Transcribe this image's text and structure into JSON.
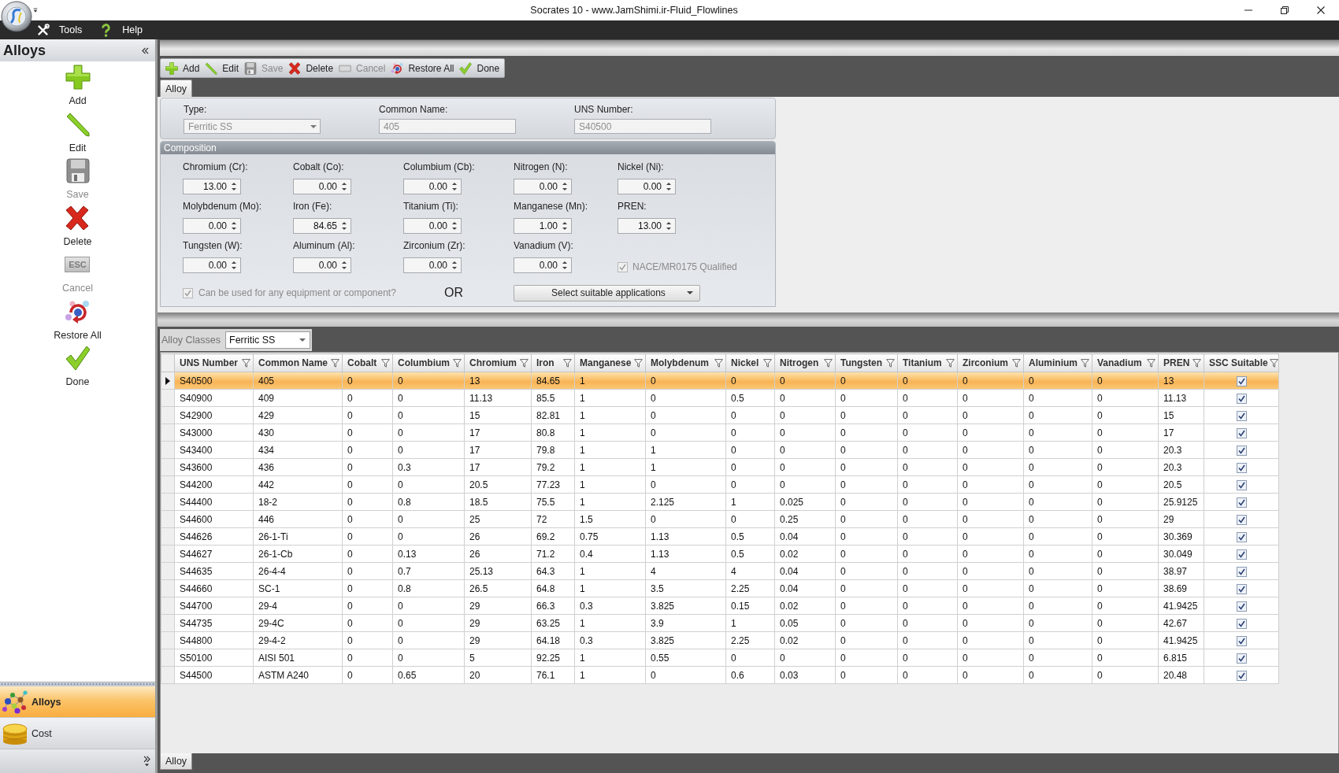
{
  "window": {
    "title": "Socrates 10 - www.JamShimi.ir-Fluid_Flowlines"
  },
  "menu": [
    {
      "label": "Tools"
    },
    {
      "label": "Help"
    }
  ],
  "sidebar": {
    "title": "Alloys",
    "actions": [
      {
        "label": "Add",
        "disabled": false
      },
      {
        "label": "Edit",
        "disabled": false
      },
      {
        "label": "Save",
        "disabled": true
      },
      {
        "label": "Delete",
        "disabled": false
      },
      {
        "label": "Cancel",
        "disabled": true,
        "key_label": "ESC"
      },
      {
        "label": "Restore All",
        "disabled": false
      },
      {
        "label": "Done",
        "disabled": false
      }
    ],
    "nav": [
      {
        "label": "Alloys",
        "selected": true
      },
      {
        "label": "Cost",
        "selected": false
      }
    ]
  },
  "toolbar": {
    "actions": [
      {
        "label": "Add",
        "disabled": false
      },
      {
        "label": "Edit",
        "disabled": false
      },
      {
        "label": "Save",
        "disabled": true
      },
      {
        "label": "Delete",
        "disabled": false
      },
      {
        "label": "Cancel",
        "disabled": true
      },
      {
        "label": "Restore All",
        "disabled": false
      },
      {
        "label": "Done",
        "disabled": false
      }
    ]
  },
  "tabs": [
    {
      "label": "Alloy",
      "selected": true
    }
  ],
  "form": {
    "header_fields": [
      {
        "kind": "dropdown",
        "label": "Type:",
        "value": "Ferritic SS",
        "disabled": true
      },
      {
        "kind": "text",
        "label": "Common Name:",
        "value": "405",
        "disabled": true
      },
      {
        "kind": "text",
        "label": "UNS Number:",
        "value": "S40500",
        "disabled": true
      }
    ],
    "composition": {
      "title": "Composition",
      "fields": [
        {
          "label": "Chromium (Cr):",
          "value": "13.00"
        },
        {
          "label": "Cobalt (Co):",
          "value": "0.00"
        },
        {
          "label": "Columbium (Cb):",
          "value": "0.00"
        },
        {
          "label": "Nitrogen (N):",
          "value": "0.00"
        },
        {
          "label": "Nickel (Ni):",
          "value": "0.00"
        },
        {
          "label": "Molybdenum (Mo):",
          "value": "0.00"
        },
        {
          "label": "Iron (Fe):",
          "value": "84.65"
        },
        {
          "label": "Titanium (Ti):",
          "value": "0.00"
        },
        {
          "label": "Manganese (Mn):",
          "value": "1.00"
        },
        {
          "label": "PREN:",
          "value": "13.00"
        },
        {
          "label": "Tungsten (W):",
          "value": "0.00"
        },
        {
          "label": "Aluminum (Al):",
          "value": "0.00"
        },
        {
          "label": "Zirconium (Zr):",
          "value": "0.00"
        },
        {
          "label": "Vanadium (V):",
          "value": "0.00"
        }
      ]
    },
    "nace": {
      "label": "NACE/MR0175 Qualified",
      "checked": true,
      "disabled": true
    },
    "any_equipment": {
      "label": "Can be used for any equipment or component?",
      "checked": true,
      "disabled": true
    },
    "or_text": "OR",
    "applications": {
      "label": "Select suitable applications"
    }
  },
  "alloy_classes": {
    "label": "Alloy Classes",
    "value": "Ferritic SS"
  },
  "table": {
    "columns": [
      "UNS Number",
      "Common Name",
      "Cobalt",
      "Columbium",
      "Chromium",
      "Iron",
      "Manganese",
      "Molybdenum",
      "Nickel",
      "Nitrogen",
      "Tungsten",
      "Titanium",
      "Zirconium",
      "Aluminium",
      "Vanadium",
      "PREN",
      "SSC Suitable"
    ],
    "rows": [
      {
        "selected": true,
        "cells": [
          "S40500",
          "405",
          "0",
          "0",
          "13",
          "84.65",
          "1",
          "0",
          "0",
          "0",
          "0",
          "0",
          "0",
          "0",
          "0",
          "13"
        ],
        "ssc_suitable": true
      },
      {
        "selected": false,
        "cells": [
          "S40900",
          "409",
          "0",
          "0",
          "11.13",
          "85.5",
          "1",
          "0",
          "0.5",
          "0",
          "0",
          "0",
          "0",
          "0",
          "0",
          "11.13"
        ],
        "ssc_suitable": true
      },
      {
        "selected": false,
        "cells": [
          "S42900",
          "429",
          "0",
          "0",
          "15",
          "82.81",
          "1",
          "0",
          "0",
          "0",
          "0",
          "0",
          "0",
          "0",
          "0",
          "15"
        ],
        "ssc_suitable": true
      },
      {
        "selected": false,
        "cells": [
          "S43000",
          "430",
          "0",
          "0",
          "17",
          "80.8",
          "1",
          "0",
          "0",
          "0",
          "0",
          "0",
          "0",
          "0",
          "0",
          "17"
        ],
        "ssc_suitable": true
      },
      {
        "selected": false,
        "cells": [
          "S43400",
          "434",
          "0",
          "0",
          "17",
          "79.8",
          "1",
          "1",
          "0",
          "0",
          "0",
          "0",
          "0",
          "0",
          "0",
          "20.3"
        ],
        "ssc_suitable": true
      },
      {
        "selected": false,
        "cells": [
          "S43600",
          "436",
          "0",
          "0.3",
          "17",
          "79.2",
          "1",
          "1",
          "0",
          "0",
          "0",
          "0",
          "0",
          "0",
          "0",
          "20.3"
        ],
        "ssc_suitable": true
      },
      {
        "selected": false,
        "cells": [
          "S44200",
          "442",
          "0",
          "0",
          "20.5",
          "77.23",
          "1",
          "0",
          "0",
          "0",
          "0",
          "0",
          "0",
          "0",
          "0",
          "20.5"
        ],
        "ssc_suitable": true
      },
      {
        "selected": false,
        "cells": [
          "S44400",
          "18-2",
          "0",
          "0.8",
          "18.5",
          "75.5",
          "1",
          "2.125",
          "1",
          "0.025",
          "0",
          "0",
          "0",
          "0",
          "0",
          "25.9125"
        ],
        "ssc_suitable": true
      },
      {
        "selected": false,
        "cells": [
          "S44600",
          "446",
          "0",
          "0",
          "25",
          "72",
          "1.5",
          "0",
          "0",
          "0.25",
          "0",
          "0",
          "0",
          "0",
          "0",
          "29"
        ],
        "ssc_suitable": true
      },
      {
        "selected": false,
        "cells": [
          "S44626",
          "26-1-Ti",
          "0",
          "0",
          "26",
          "69.2",
          "0.75",
          "1.13",
          "0.5",
          "0.04",
          "0",
          "0",
          "0",
          "0",
          "0",
          "30.369"
        ],
        "ssc_suitable": true
      },
      {
        "selected": false,
        "cells": [
          "S44627",
          "26-1-Cb",
          "0",
          "0.13",
          "26",
          "71.2",
          "0.4",
          "1.13",
          "0.5",
          "0.02",
          "0",
          "0",
          "0",
          "0",
          "0",
          "30.049"
        ],
        "ssc_suitable": true
      },
      {
        "selected": false,
        "cells": [
          "S44635",
          "26-4-4",
          "0",
          "0.7",
          "25.13",
          "64.3",
          "1",
          "4",
          "4",
          "0.04",
          "0",
          "0",
          "0",
          "0",
          "0",
          "38.97"
        ],
        "ssc_suitable": true
      },
      {
        "selected": false,
        "cells": [
          "S44660",
          "SC-1",
          "0",
          "0.8",
          "26.5",
          "64.8",
          "1",
          "3.5",
          "2.25",
          "0.04",
          "0",
          "0",
          "0",
          "0",
          "0",
          "38.69"
        ],
        "ssc_suitable": true
      },
      {
        "selected": false,
        "cells": [
          "S44700",
          "29-4",
          "0",
          "0",
          "29",
          "66.3",
          "0.3",
          "3.825",
          "0.15",
          "0.02",
          "0",
          "0",
          "0",
          "0",
          "0",
          "41.9425"
        ],
        "ssc_suitable": true
      },
      {
        "selected": false,
        "cells": [
          "S44735",
          "29-4C",
          "0",
          "0",
          "29",
          "63.25",
          "1",
          "3.9",
          "1",
          "0.05",
          "0",
          "0",
          "0",
          "0",
          "0",
          "42.67"
        ],
        "ssc_suitable": true
      },
      {
        "selected": false,
        "cells": [
          "S44800",
          "29-4-2",
          "0",
          "0",
          "29",
          "64.18",
          "0.3",
          "3.825",
          "2.25",
          "0.02",
          "0",
          "0",
          "0",
          "0",
          "0",
          "41.9425"
        ],
        "ssc_suitable": true
      },
      {
        "selected": false,
        "cells": [
          "S50100",
          "AISI 501",
          "0",
          "0",
          "5",
          "92.25",
          "1",
          "0.55",
          "0",
          "0",
          "0",
          "0",
          "0",
          "0",
          "0",
          "6.815"
        ],
        "ssc_suitable": true
      },
      {
        "selected": false,
        "cells": [
          "S44500",
          "ASTM A240",
          "0",
          "0.65",
          "20",
          "76.1",
          "1",
          "0",
          "0.6",
          "0.03",
          "0",
          "0",
          "0",
          "0",
          "0",
          "20.48"
        ],
        "ssc_suitable": true
      }
    ]
  },
  "bottom_tabs": [
    {
      "label": "Alloy",
      "selected": true
    }
  ]
}
